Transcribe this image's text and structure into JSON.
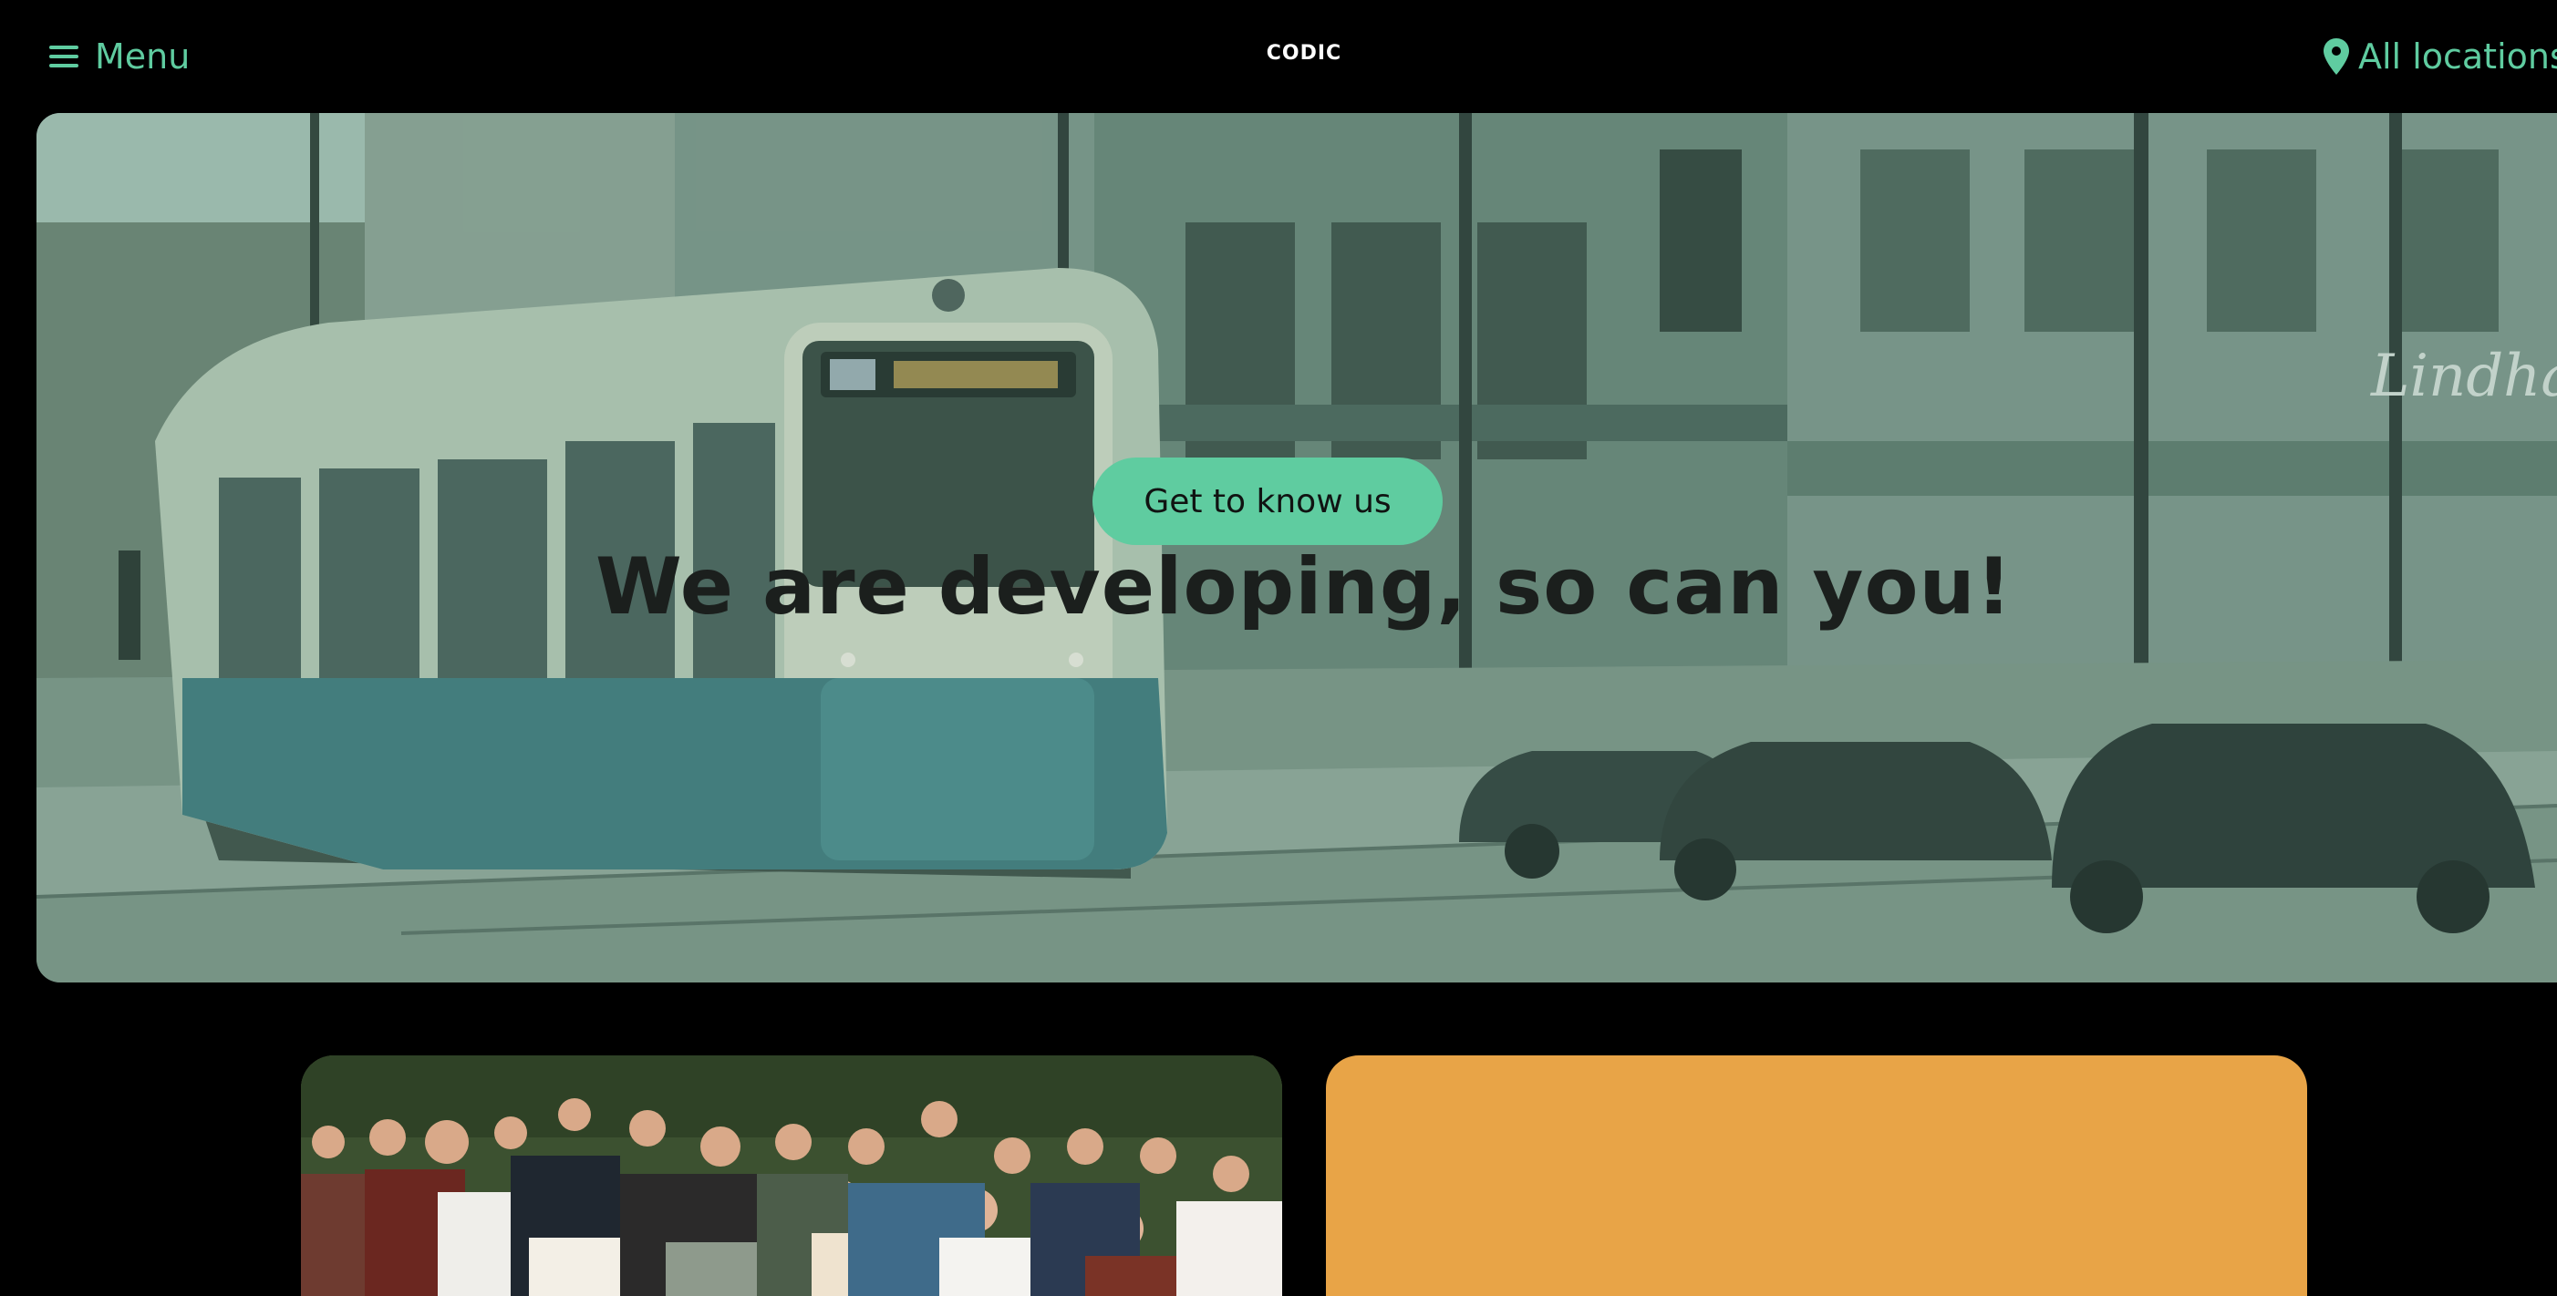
{
  "header": {
    "menu_label": "Menu",
    "menu_icon": "hamburger-icon",
    "logo_text": "CODIC",
    "locations_label": "All locations",
    "locations_icon": "map-pin-icon"
  },
  "hero": {
    "title": "We are developing, so can you!",
    "cta_label": "Get to know us",
    "image_description": "tram-street-photo"
  },
  "cards": {
    "team_image": "team-group-photo",
    "orange_card": ""
  },
  "colors": {
    "accent": "#5fcca0",
    "background": "#000000",
    "orange": "#e8a447",
    "title": "#1b1f1d"
  }
}
